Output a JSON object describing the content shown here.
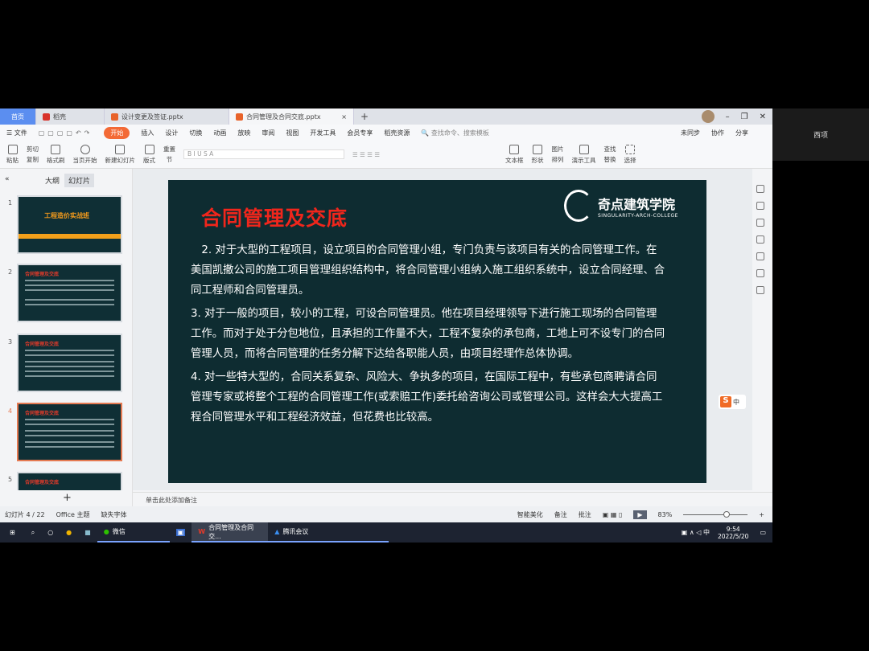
{
  "tabs": [
    {
      "label": "首页"
    },
    {
      "label": "稻壳"
    },
    {
      "label": "设计变更及签证.pptx"
    },
    {
      "label": "合同管理及合同交底.pptx"
    }
  ],
  "menu": {
    "file": "文件",
    "items": [
      "开始",
      "插入",
      "设计",
      "切换",
      "动画",
      "放映",
      "审阅",
      "视图",
      "开发工具",
      "会员专享",
      "稻壳资源"
    ],
    "search": "查找命令、搜索模板",
    "sync": "未同步",
    "collab": "协作",
    "share": "分享"
  },
  "toolbar": [
    "粘贴",
    "剪切",
    "复制",
    "格式刷",
    "当页开始",
    "新建幻灯片",
    "版式",
    "节",
    "重置",
    "文本框",
    "形状",
    "图片",
    "排列",
    "演示工具",
    "查找",
    "替换",
    "选择"
  ],
  "left": {
    "tab_outline": "大纲",
    "tab_slides": "幻灯片",
    "slide1_title": "工程造价实战班",
    "slide_title": "合同管理及交底",
    "numbers": [
      "1",
      "2",
      "3",
      "4",
      "5"
    ]
  },
  "slide": {
    "title": "合同管理及交底",
    "logo_name": "奇点建筑学院",
    "logo_sub": "SINGULARITY-ARCH-COLLEGE",
    "paragraphs": [
      "　2. 对于大型的工程项目，设立项目的合同管理小组，专门负责与该项目有关的合同管理工作。在美国凯撒公司的施工项目管理组织结构中，将合同管理小组纳入施工组织系统中，设立合同经理、合同工程师和合同管理员。",
      "3. 对于一般的项目，较小的工程，可设合同管理员。他在项目经理领导下进行施工现场的合同管理工作。而对于处于分包地位，且承担的工作量不大，工程不复杂的承包商，工地上可不设专门的合同管理人员，而将合同管理的任务分解下达给各职能人员，由项目经理作总体协调。",
      "4. 对一些特大型的，合同关系复杂、风险大、争执多的项目，在国际工程中，有些承包商聘请合同管理专家或将整个工程的合同管理工作(或索赔工作)委托给咨询公司或管理公司。这样会大大提高工程合同管理水平和工程经济效益，但花费也比较高。"
    ]
  },
  "notes_placeholder": "单击此处添加备注",
  "status": {
    "slide_count": "幻灯片 4 / 22",
    "theme": "Office 主题",
    "font": "缺失字体",
    "beautify": "智能美化",
    "notes": "备注",
    "comment": "批注",
    "zoom": "83%"
  },
  "taskbar": {
    "wechat": "微信",
    "wps": "合同管理及合同交...",
    "meeting": "腾讯会议",
    "time": "9:54",
    "date": "2022/5/20"
  },
  "right_label": "西项",
  "ime": "中",
  "colors": {
    "slide_bg": "#0e2c31",
    "title_red": "#f0261c",
    "accent": "#f36a36"
  }
}
